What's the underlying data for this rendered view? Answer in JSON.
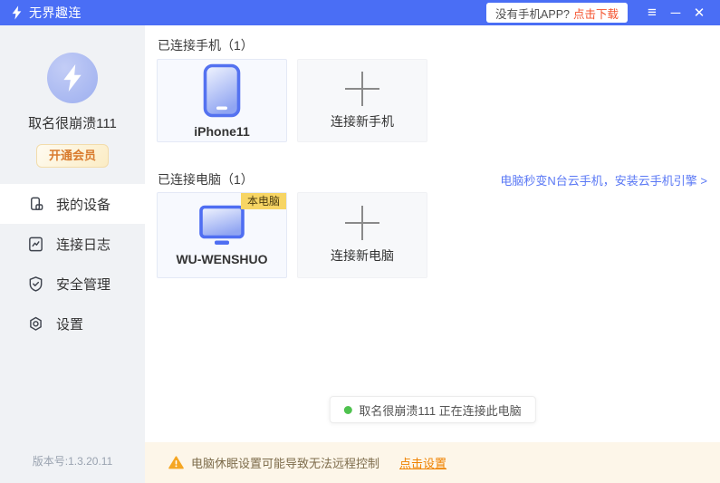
{
  "titlebar": {
    "app_name": "无界趣连",
    "download_prompt": "没有手机APP?",
    "download_link": "点击下载",
    "controls": {
      "menu": "≡",
      "minimize": "─",
      "close": "✕"
    }
  },
  "sidebar": {
    "username": "取名很崩溃111",
    "vip_button": "开通会员",
    "menu": [
      {
        "label": "我的设备",
        "icon": "devices-icon",
        "active": true
      },
      {
        "label": "连接日志",
        "icon": "log-icon",
        "active": false
      },
      {
        "label": "安全管理",
        "icon": "shield-icon",
        "active": false
      },
      {
        "label": "设置",
        "icon": "settings-icon",
        "active": false
      }
    ],
    "version": "版本号:1.3.20.11"
  },
  "main": {
    "phones_section": {
      "title": "已连接手机（1）",
      "devices": [
        {
          "name": "iPhone11"
        }
      ],
      "add_label": "连接新手机"
    },
    "computers_section": {
      "title": "已连接电脑（1）",
      "promo_link": "电脑秒变N台云手机，安装云手机引擎 >",
      "devices": [
        {
          "name": "WU-WENSHUO",
          "tag": "本电脑"
        }
      ],
      "add_label": "连接新电脑"
    },
    "status_toast": "取名很崩溃111 正在连接此电脑",
    "warning": {
      "text": "电脑休眠设置可能导致无法远程控制",
      "link": "点击设置"
    }
  },
  "colors": {
    "titlebar_blue": "#4a6ef5",
    "device_icon_blue": "#5472f0",
    "promo_link_blue": "#5a78f5",
    "vip_orange": "#d97b2e",
    "download_link_red": "#f4512c",
    "warning_bg": "#fdf6e9",
    "warning_triangle": "#f5a623",
    "warning_link_orange": "#ef8200",
    "tag_yellow": "#f7d564",
    "status_green": "#4fc24f"
  }
}
